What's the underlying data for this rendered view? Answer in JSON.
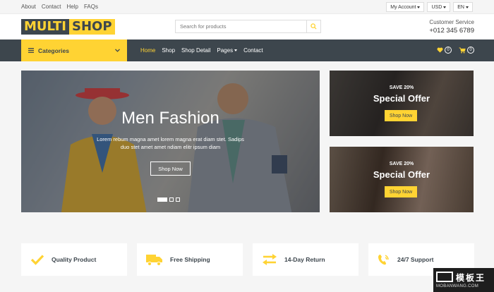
{
  "topbar": {
    "links": [
      "About",
      "Contact",
      "Help",
      "FAQs"
    ],
    "account": "My Account",
    "currency": "USD",
    "language": "EN"
  },
  "brand": {
    "logo_part1": "MULTI",
    "logo_part2": "SHOP",
    "search_placeholder": "Search for products",
    "customer_service_label": "Customer Service",
    "phone": "+012 345 6789"
  },
  "nav": {
    "categories_label": "Categories",
    "items": [
      "Home",
      "Shop",
      "Shop Detail",
      "Pages",
      "Contact"
    ],
    "wishlist_count": "0",
    "cart_count": "0"
  },
  "hero": {
    "title": "Men Fashion",
    "description": "Lorem rebum magna amet lorem magna erat diam stet. Sadips duo stet amet amet ndiam elitr ipsum diam",
    "button": "Shop Now",
    "slides": 3,
    "active_slide": 1
  },
  "offers": [
    {
      "save": "SAVE 20%",
      "title": "Special Offer",
      "button": "Shop Now"
    },
    {
      "save": "SAVE 20%",
      "title": "Special Offer",
      "button": "Shop Now"
    }
  ],
  "features": [
    {
      "label": "Quality Product",
      "icon": "check-icon"
    },
    {
      "label": "Free Shipping",
      "icon": "truck-icon"
    },
    {
      "label": "14-Day Return",
      "icon": "exchange-icon"
    },
    {
      "label": "24/7 Support",
      "icon": "phone-volume-icon"
    }
  ],
  "watermark": {
    "cn": "模板王",
    "url": "MOBANWANG.COM"
  },
  "colors": {
    "accent": "#FFD333",
    "dark": "#3D464D"
  }
}
